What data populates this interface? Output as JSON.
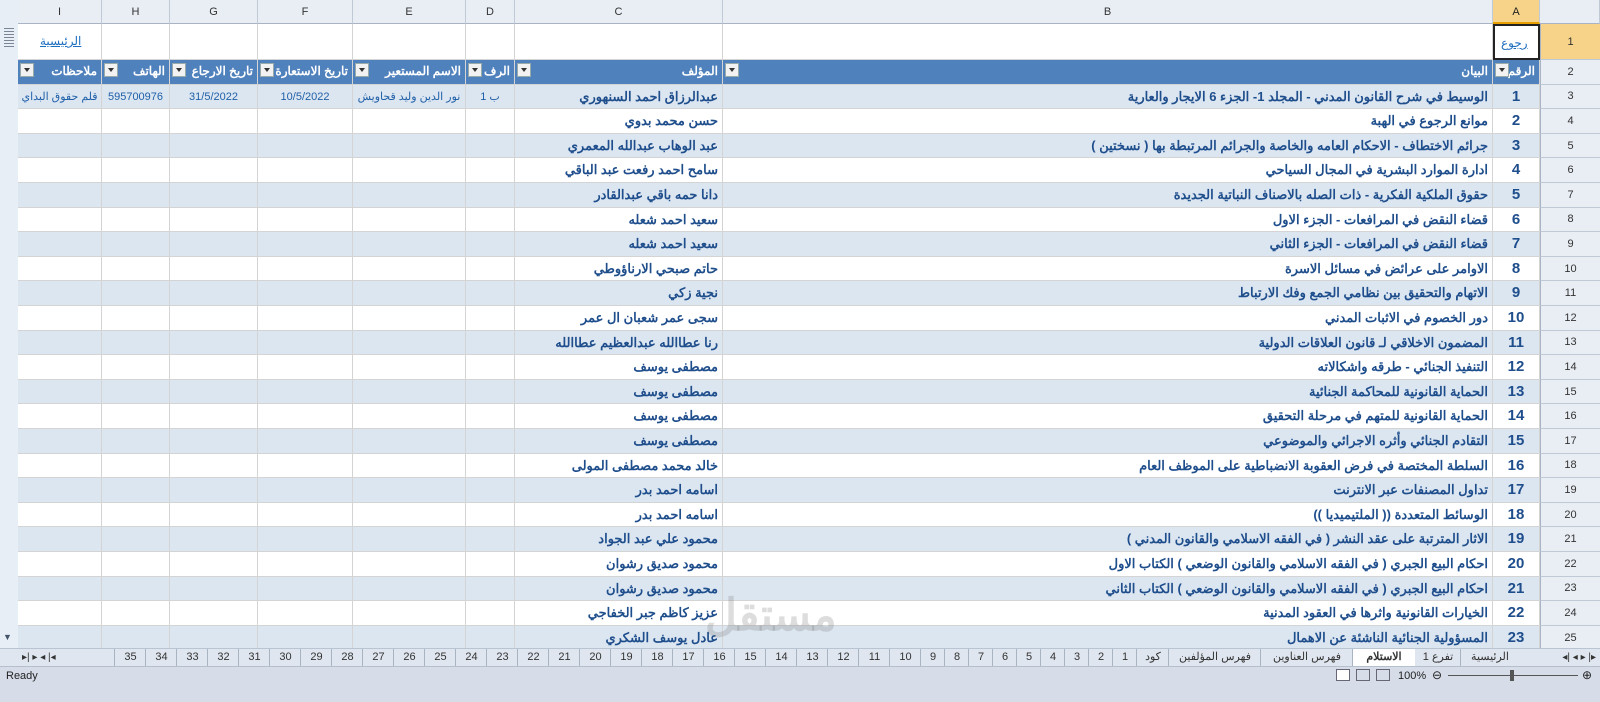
{
  "column_headers": [
    "I",
    "H",
    "G",
    "F",
    "E",
    "D",
    "C",
    "B",
    "A"
  ],
  "selected_column": "A",
  "links": {
    "back": "رجوع",
    "home": "الرئيسية"
  },
  "table_headers": {
    "A": "الرقم",
    "B": "البيان",
    "C": "المؤلف",
    "D": "الرف",
    "E": "الاسم المستعير",
    "F": "تاريخ الاستعارة",
    "G": "تاريخ الارجاع",
    "H": "الهاتف",
    "I": "ملاحظات"
  },
  "rows": [
    {
      "n": "1",
      "title": "الوسيط في شرح القانون المدني - المجلد 1- الجزء 6 الايجار والعارية",
      "author": "عبدالرزاق احمد السنهوري",
      "shelf": "ب 1",
      "borrower": "نور الدين وليد قحاويش",
      "borrow_date": "10/5/2022",
      "return_date": "31/5/2022",
      "phone": "595700976",
      "notes": "قلم حقوق البداي"
    },
    {
      "n": "2",
      "title": "موانع الرجوع في الهبة",
      "author": "حسن محمد بدوي"
    },
    {
      "n": "3",
      "title": "جرائم الاختطاف - الاحكام العامه والخاصة والجرائم المرتبطة بها ( نسختين )",
      "author": "عبد الوهاب عبدالله المعمري"
    },
    {
      "n": "4",
      "title": "ادارة الموارد البشرية في المجال السياحي",
      "author": "سامح احمد رفعت عبد الباقي"
    },
    {
      "n": "5",
      "title": "حقوق الملكية الفكرية - ذات الصله بالاصناف النباتية الجديدة",
      "author": "دانا حمه باقي عبدالقادر"
    },
    {
      "n": "6",
      "title": "قضاء النقض في المرافعات - الجزء الاول",
      "author": "سعيد احمد شعله"
    },
    {
      "n": "7",
      "title": "قضاء النقض في المرافعات - الجزء الثاني",
      "author": "سعيد احمد شعله"
    },
    {
      "n": "8",
      "title": "الاوامر على عرائض في مسائل الاسرة",
      "author": "حاتم صبحي الارناؤوطي"
    },
    {
      "n": "9",
      "title": "الاتهام والتحقيق بين نظامي الجمع وفك الارتباط",
      "author": "نجية زكي"
    },
    {
      "n": "10",
      "title": "دور الخصوم في الاثبات المدني",
      "author": "سجى عمر شعبان ال عمر"
    },
    {
      "n": "11",
      "title": "المضمون الاخلاقي لـ قانون العلاقات الدولية",
      "author": "رنا عطاالله عبدالعظيم عطاالله"
    },
    {
      "n": "12",
      "title": "التنفيذ الجنائي - طرقه واشكالاته",
      "author": "مصطفى يوسف"
    },
    {
      "n": "13",
      "title": "الحماية القانونية للمحاكمة الجنائية",
      "author": "مصطفى يوسف"
    },
    {
      "n": "14",
      "title": "الحماية القانونية للمتهم في مرحلة التحقيق",
      "author": "مصطفى يوسف"
    },
    {
      "n": "15",
      "title": "التقادم الجنائي وأثره الاجرائي والموضوعي",
      "author": "مصطفى يوسف"
    },
    {
      "n": "16",
      "title": "السلطة المختصة في فرض العقوبة الانضباطية على الموظف العام",
      "author": "خالد محمد مصطفى المولى"
    },
    {
      "n": "17",
      "title": "تداول المصنفات عبر الانترنت",
      "author": "اسامه احمد بدر"
    },
    {
      "n": "18",
      "title": "الوسائط المتعددة (( الملتيميديا ))",
      "author": "اسامه احمد بدر"
    },
    {
      "n": "19",
      "title": "الاثار المترتبة على عقد النشر ( في الفقه الاسلامي والقانون المدني )",
      "author": "محمود علي عبد الجواد"
    },
    {
      "n": "20",
      "title": "احكام البيع الجبري ( في الفقه الاسلامي والقانون الوضعي ) الكتاب الاول",
      "author": "محمود صديق رشوان"
    },
    {
      "n": "21",
      "title": "احكام البيع الجبري ( في الفقه الاسلامي والقانون الوضعي ) الكتاب الثاني",
      "author": "محمود صديق رشوان"
    },
    {
      "n": "22",
      "title": "الخيارات القانونية واثرها في العقود المدنية",
      "author": "عزيز كاظم جبر الخفاجي"
    },
    {
      "n": "23",
      "title": "المسؤولية الجنائية الناشئة عن الاهمال",
      "author": "عادل يوسف الشكري"
    }
  ],
  "row_numbers": [
    "1",
    "2",
    "3",
    "4",
    "5",
    "6",
    "7",
    "8",
    "9",
    "10",
    "11",
    "12",
    "13",
    "14",
    "15",
    "16",
    "17",
    "18",
    "19",
    "20",
    "21",
    "22",
    "23",
    "24",
    "25"
  ],
  "sheet_tabs": [
    "الرئيسية",
    "تفرع 1",
    "الاستلام",
    "فهرس العناوين",
    "فهرس المؤلفين",
    "كود",
    "1",
    "2",
    "3",
    "4",
    "5",
    "6",
    "7",
    "8",
    "9",
    "10",
    "11",
    "12",
    "13",
    "14",
    "15",
    "16",
    "17",
    "18",
    "19",
    "20",
    "21",
    "22",
    "23",
    "24",
    "25",
    "26",
    "27",
    "28",
    "29",
    "30",
    "31",
    "32",
    "33",
    "34",
    "35"
  ],
  "active_tab": "الاستلام",
  "status": {
    "ready": "Ready",
    "zoom": "100%"
  },
  "watermark": "مستقل",
  "colors": {
    "header_blue": "#4f81bd",
    "band": "#dce6f1",
    "text_blue": "#1f4e8c"
  }
}
